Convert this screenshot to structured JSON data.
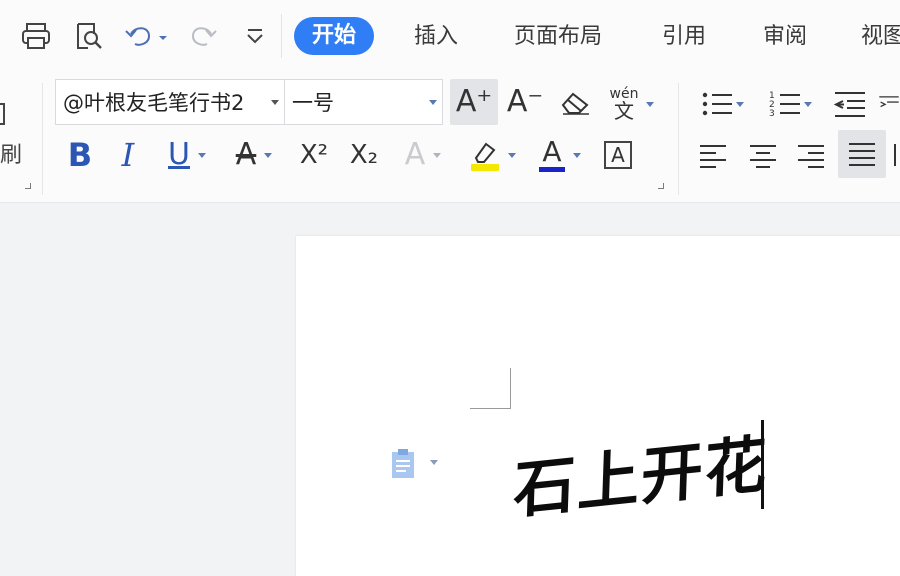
{
  "menu": {
    "tabs": [
      {
        "label": "开始",
        "active": true
      },
      {
        "label": "插入"
      },
      {
        "label": "页面布局"
      },
      {
        "label": "引用"
      },
      {
        "label": "审阅"
      },
      {
        "label": "视图"
      }
    ],
    "accent": "#2f7ef5"
  },
  "quick_access": {
    "icons": [
      "print-icon",
      "print-preview-icon",
      "undo-icon",
      "redo-icon",
      "customize-icon"
    ]
  },
  "ribbon": {
    "clipboard_label": "刷",
    "font_name": "@叶根友毛笔行书2",
    "font_size": "一号",
    "grow_font": "A⁺",
    "shrink_font": "A⁻",
    "phonetic_label": "wén",
    "phonetic_char": "文",
    "bold": "B",
    "italic": "I",
    "underline": "U",
    "strikethrough": "A",
    "superscript": "X²",
    "subscript": "X₂",
    "text_effect": "A",
    "font_color_letter": "A",
    "char_border_letter": "A",
    "highlight_color": "#f5e800",
    "font_color": "#1a23c8"
  },
  "document": {
    "text": "石上开花",
    "text_color": "#0c0c0c"
  }
}
